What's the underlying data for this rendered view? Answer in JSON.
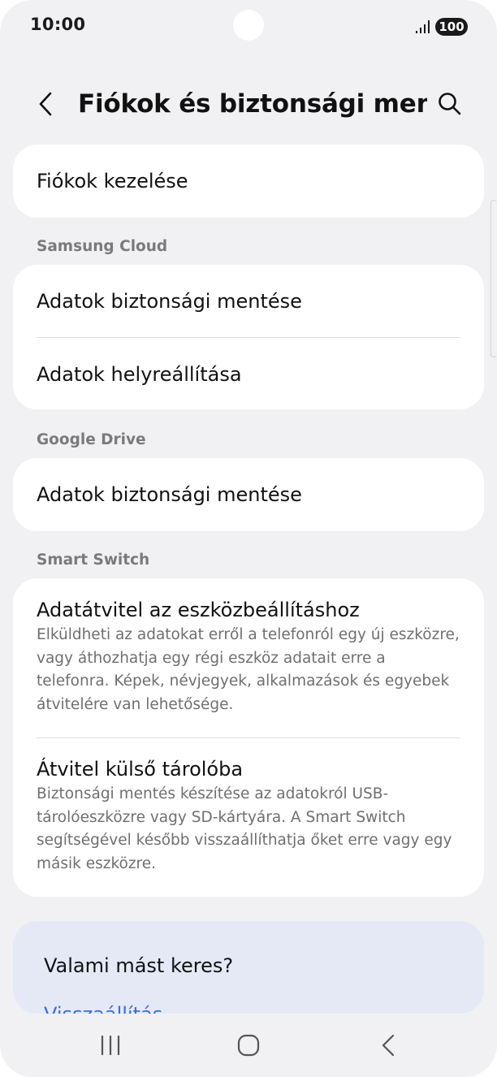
{
  "status_bar": {
    "time": "10:00",
    "battery": "100"
  },
  "header": {
    "title": "Fiókok és biztonsági men..."
  },
  "accounts_card": {
    "manage_accounts": "Fiókok kezelése"
  },
  "samsung_cloud": {
    "label": "Samsung Cloud",
    "backup": "Adatok biztonsági mentése",
    "restore": "Adatok helyreállítása"
  },
  "google_drive": {
    "label": "Google Drive",
    "backup": "Adatok biztonsági mentése"
  },
  "smart_switch": {
    "label": "Smart Switch",
    "transfer_title": "Adatátvitel az eszközbeállításhoz",
    "transfer_desc": "Elküldheti az adatokat erről a telefonról egy új eszközre, vagy áthozhatja egy régi eszköz adatait erre a telefonra. Képek, névjegyek, alkalmazások és egyebek átvitelére van lehetősége.",
    "external_title": "Átvitel külső tárolóba",
    "external_desc": "Biztonsági mentés készítése az adatokról USB-tárolóeszközre vagy SD-kártyára. A Smart Switch segítségével később visszaállíthatja őket erre vagy egy másik eszközre."
  },
  "suggestions": {
    "title": "Valami mást keres?",
    "link": "Visszaállítás"
  },
  "icons": {
    "back": "chevron-left-icon",
    "search": "search-icon",
    "recents": "recents-icon",
    "home": "home-icon",
    "nav_back": "nav-back-icon",
    "signal": "signal-icon"
  }
}
